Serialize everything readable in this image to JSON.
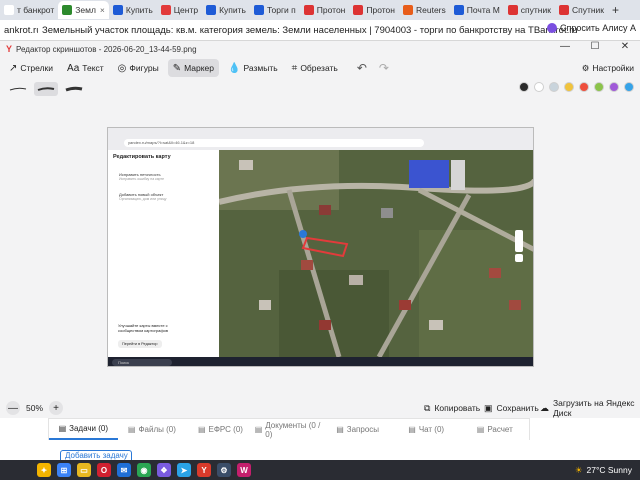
{
  "browser": {
    "tabs": [
      {
        "label": "т банкрот",
        "color": "#ffffff",
        "active": false
      },
      {
        "label": "Земл",
        "color": "#2d8a2d",
        "active": true,
        "close": "×"
      },
      {
        "label": "Купить",
        "color": "#1e5bd6",
        "active": false
      },
      {
        "label": "Центр",
        "color": "#e23b3b",
        "active": false
      },
      {
        "label": "Купить",
        "color": "#1e5bd6",
        "active": false
      },
      {
        "label": "Торги п",
        "color": "#1e5bd6",
        "active": false
      },
      {
        "label": "Протон",
        "color": "#d33",
        "active": false
      },
      {
        "label": "Протон",
        "color": "#d33",
        "active": false
      },
      {
        "label": "Reuters",
        "color": "#e85d1a",
        "active": false
      },
      {
        "label": "Почта М",
        "color": "#1e5bd6",
        "active": false
      },
      {
        "label": "спутник",
        "color": "#d33",
        "active": false
      },
      {
        "label": "Спутник",
        "color": "#d33",
        "active": false
      }
    ],
    "new_tab": "+",
    "site_label": "ankrot.ru",
    "page_title": "Земельный участок площадь: кв.м. категория земель: Земли населенных | 7904003 - торги по банкротству на TBankrot.ru",
    "ask_label": "Спросить Алису А"
  },
  "editor": {
    "window_title": "Редактор скриншотов - 2026-06-20_13-44-59.png",
    "window_controls": [
      "—",
      "☐",
      "✕"
    ],
    "tools": [
      {
        "label": "Стрелки",
        "icon": "arrow-icon",
        "glyph": "↗",
        "selected": false
      },
      {
        "label": "Текст",
        "icon": "text-icon",
        "glyph": "Aa",
        "selected": false
      },
      {
        "label": "Фигуры",
        "icon": "shapes-icon",
        "glyph": "◎",
        "selected": false
      },
      {
        "label": "Маркер",
        "icon": "marker-icon",
        "glyph": "✎",
        "selected": true
      },
      {
        "label": "Размыть",
        "icon": "blur-icon",
        "glyph": "💧",
        "selected": false
      },
      {
        "label": "Обрезать",
        "icon": "crop-icon",
        "glyph": "⌗",
        "selected": false
      }
    ],
    "undo_glyph": "↶",
    "redo_glyph": "↷",
    "settings_label": "Настройки",
    "colors": [
      "#2b2b2b",
      "#ffffff",
      "#c9d4dc",
      "#f0c33c",
      "#ee4f3c",
      "#8bc34a",
      "#a05ad8",
      "#36a3e8"
    ],
    "zoom": "50%",
    "zoom_out": "—",
    "zoom_in": "+",
    "actions": {
      "copy": "Копировать",
      "save": "Сохранить",
      "upload": "Загрузить на Яндекс Диск"
    }
  },
  "screenshot": {
    "address": "yandex.ru/maps/?l=sat&ll=46.1&z=18",
    "panel_title": "Редактировать карту",
    "panel_items": [
      {
        "label": "Исправить неточность",
        "hint": "Исправить ошибку на карте"
      },
      {
        "label": "Добавить новый объект",
        "hint": "Организацию, дом или улицу"
      }
    ],
    "promo_text": "Улучшайте карты вместе с сообществом картографов",
    "promo_button": "Перейти в Редактор",
    "taskbar_search": "Поиск"
  },
  "page_tabs": [
    {
      "label": "Задачи (0)",
      "active": true
    },
    {
      "label": "Файлы (0)",
      "active": false
    },
    {
      "label": "ЕФРС (0)",
      "active": false
    },
    {
      "label": "Документы (0 / 0)",
      "active": false
    },
    {
      "label": "Запросы",
      "active": false
    },
    {
      "label": "Чат (0)",
      "active": false
    },
    {
      "label": "Расчет",
      "active": false
    }
  ],
  "add_task_label": "Добавить задачу",
  "taskbar": {
    "icons": [
      {
        "name": "copilot-icon",
        "color": "#f4b400",
        "glyph": "✦"
      },
      {
        "name": "start-icon",
        "color": "#3b82f6",
        "glyph": "⊞"
      },
      {
        "name": "file-explorer-icon",
        "color": "#e8b820",
        "glyph": "▭"
      },
      {
        "name": "opera-icon",
        "color": "#d02030",
        "glyph": "O"
      },
      {
        "name": "mail-icon",
        "color": "#1f6fd6",
        "glyph": "✉"
      },
      {
        "name": "chrome-icon",
        "color": "#2aa653",
        "glyph": "◉"
      },
      {
        "name": "photos-icon",
        "color": "#7a5be0",
        "glyph": "❖"
      },
      {
        "name": "telegram-icon",
        "color": "#2aa3e6",
        "glyph": "➤"
      },
      {
        "name": "yandex-browser-icon",
        "color": "#d93a2b",
        "glyph": "Y"
      },
      {
        "name": "steam-icon",
        "color": "#3a4d68",
        "glyph": "⚙"
      },
      {
        "name": "wildberries-icon",
        "color": "#c41f6d",
        "glyph": "W"
      }
    ],
    "weather": "27°C  Sunny"
  }
}
